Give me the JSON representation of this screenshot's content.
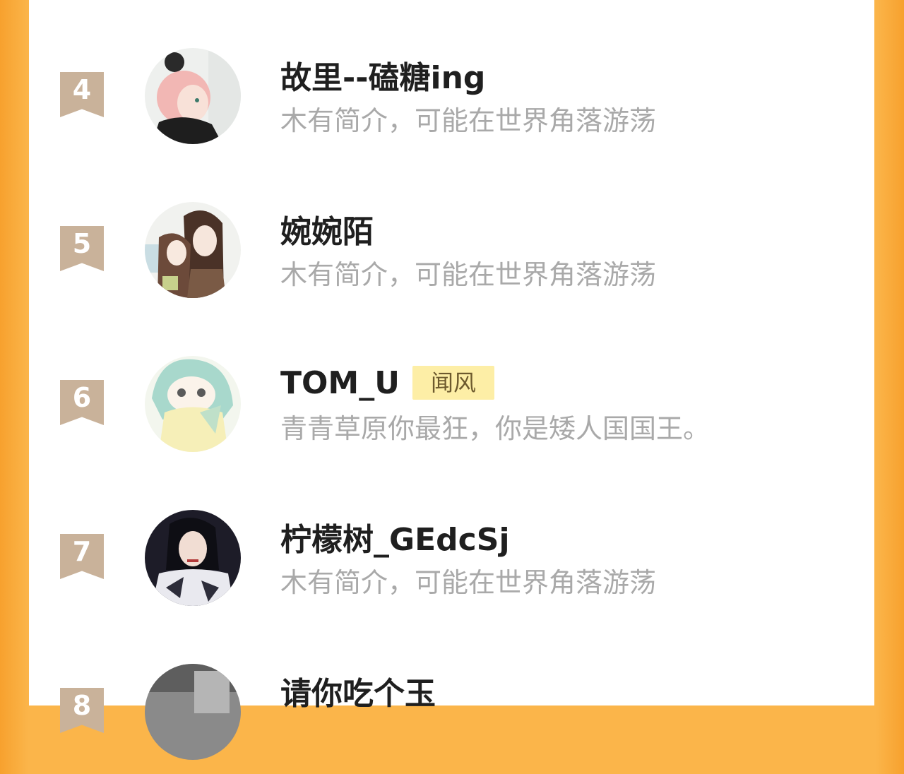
{
  "leaderboard": {
    "entries": [
      {
        "rank": "4",
        "name": "故里--磕糖ing",
        "bio": "木有简介，可能在世界角落游荡",
        "badge": "",
        "avatar_icon": "anime-girl-pink-hair-avatar"
      },
      {
        "rank": "5",
        "name": "婉婉陌",
        "bio": "木有简介，可能在世界角落游荡",
        "badge": "",
        "avatar_icon": "anime-couple-avatar"
      },
      {
        "rank": "6",
        "name": "TOM_U",
        "bio": "青青草原你最狂，你是矮人国国王。",
        "badge": "闻风",
        "avatar_icon": "chibi-teal-hair-avatar"
      },
      {
        "rank": "7",
        "name": "柠檬树_GEdcSj",
        "bio": "木有简介，可能在世界角落游荡",
        "badge": "",
        "avatar_icon": "dark-hair-girl-avatar"
      },
      {
        "rank": "8",
        "name": "请你吃个玉",
        "bio": "",
        "badge": "",
        "avatar_icon": "gray-photo-avatar"
      }
    ]
  },
  "colors": {
    "side_orange": "#f7a12e",
    "rank_badge": "#c9b29a",
    "name_text": "#1f1f1f",
    "bio_text": "#a9a9a9",
    "title_badge_bg": "#fdeea6"
  }
}
